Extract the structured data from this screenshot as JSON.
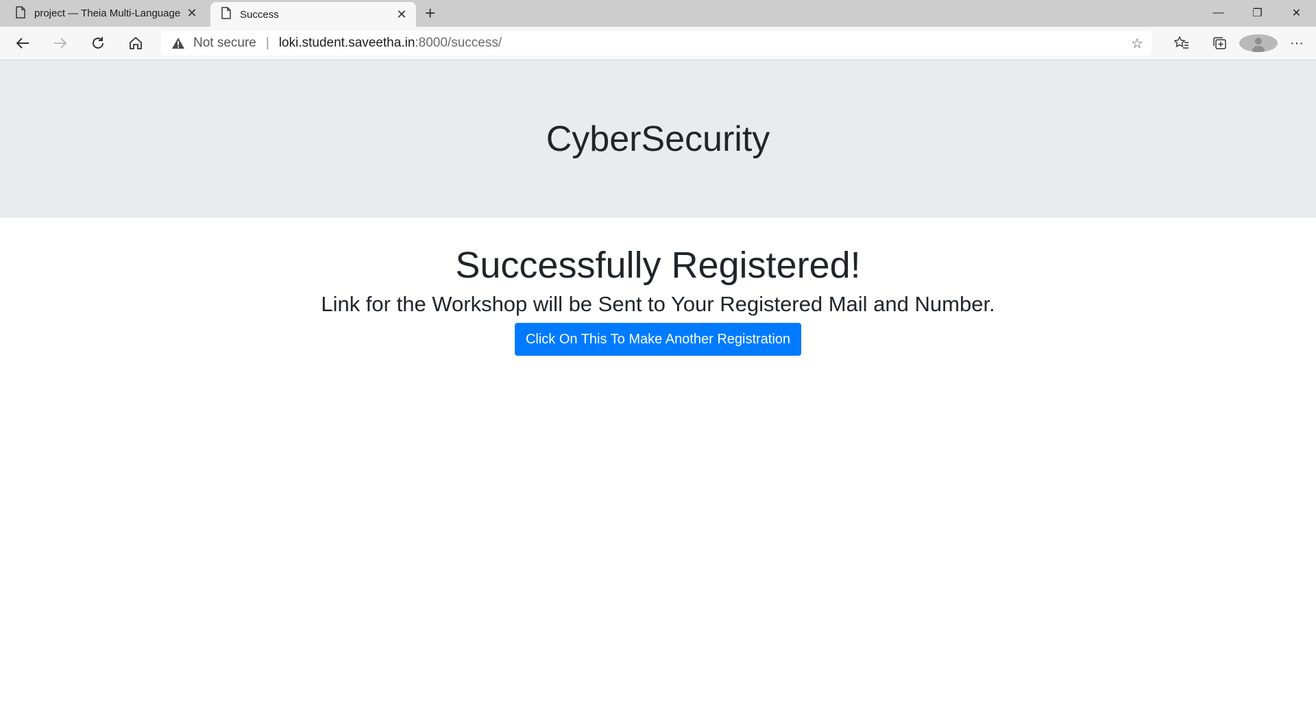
{
  "browser": {
    "tabs": [
      {
        "title": "project — Theia Multi-Language",
        "active": false
      },
      {
        "title": "Success",
        "active": true
      }
    ],
    "security_label": "Not secure",
    "url_host": "loki.student.saveetha.in",
    "url_path": ":8000/success/"
  },
  "page": {
    "brand": "CyberSecurity",
    "heading": "Successfully Registered!",
    "subheading": "Link for the Workshop will be Sent to Your Registered Mail and Number.",
    "button_label": "Click On This To Make Another Registration",
    "button_color": "#007bff",
    "jumbotron_color": "#e9ecef"
  }
}
